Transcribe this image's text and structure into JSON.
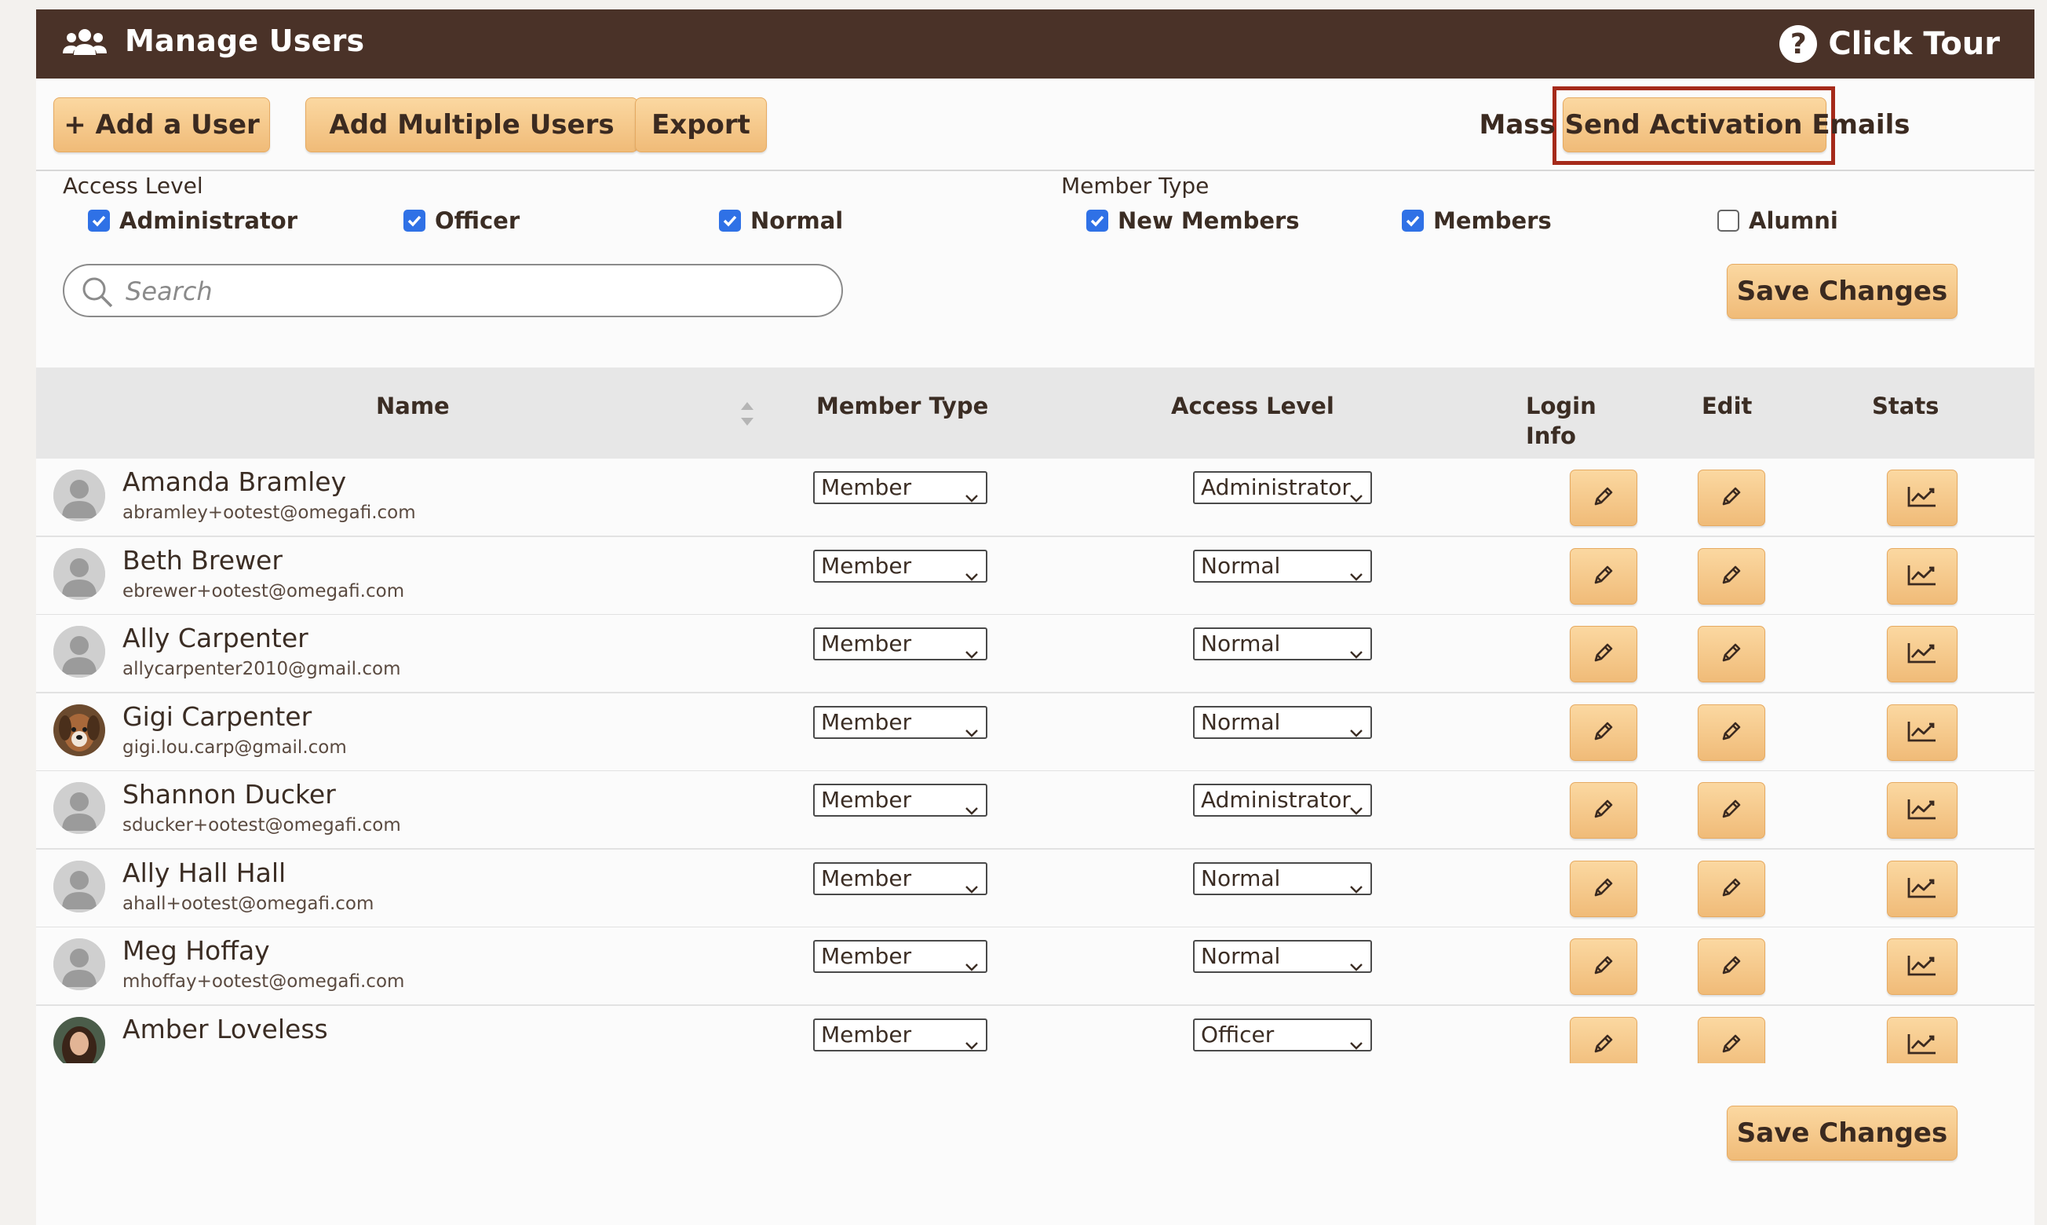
{
  "header": {
    "title": "Manage Users",
    "tour_label": "Click Tour",
    "help_glyph": "?"
  },
  "toolbar": {
    "add_user": "+ Add a User",
    "add_multiple": "Add Multiple Users",
    "export": "Export",
    "mass_send": "Mass Send Activation Emails"
  },
  "filters": {
    "access_level_label": "Access Level",
    "access_levels": [
      {
        "label": "Administrator",
        "checked": true
      },
      {
        "label": "Officer",
        "checked": true
      },
      {
        "label": "Normal",
        "checked": true
      }
    ],
    "member_type_label": "Member Type",
    "member_types": [
      {
        "label": "New Members",
        "checked": true
      },
      {
        "label": "Members",
        "checked": true
      },
      {
        "label": "Alumni",
        "checked": false
      }
    ]
  },
  "search": {
    "placeholder": "Search",
    "value": ""
  },
  "save_label": "Save Changes",
  "table": {
    "columns": {
      "name": "Name",
      "member_type": "Member Type",
      "access_level": "Access Level",
      "login_info": "Login Info",
      "edit": "Edit",
      "stats": "Stats"
    },
    "rows": [
      {
        "name": "Amanda Bramley",
        "email": "abramley+ootest@omegafi.com",
        "member_type": "Member",
        "access_level": "Administrator",
        "avatar": "placeholder"
      },
      {
        "name": "Beth Brewer",
        "email": "ebrewer+ootest@omegafi.com",
        "member_type": "Member",
        "access_level": "Normal",
        "avatar": "placeholder"
      },
      {
        "name": "Ally Carpenter",
        "email": "allycarpenter2010@gmail.com",
        "member_type": "Member",
        "access_level": "Normal",
        "avatar": "placeholder"
      },
      {
        "name": "Gigi Carpenter",
        "email": "gigi.lou.carp@gmail.com",
        "member_type": "Member",
        "access_level": "Normal",
        "avatar": "dog-photo"
      },
      {
        "name": "Shannon Ducker",
        "email": "sducker+ootest@omegafi.com",
        "member_type": "Member",
        "access_level": "Administrator",
        "avatar": "placeholder"
      },
      {
        "name": "Ally Hall Hall",
        "email": "ahall+ootest@omegafi.com",
        "member_type": "Member",
        "access_level": "Normal",
        "avatar": "placeholder"
      },
      {
        "name": "Meg Hoffay",
        "email": "mhoffay+ootest@omegafi.com",
        "member_type": "Member",
        "access_level": "Normal",
        "avatar": "placeholder"
      },
      {
        "name": "Amber Loveless",
        "email": "",
        "member_type": "Member",
        "access_level": "Officer",
        "avatar": "person-photo"
      }
    ]
  },
  "icons": {
    "header": "users-icon",
    "tour": "help-icon",
    "search": "search-icon",
    "sort": "sort-icon",
    "login": "pencil-icon",
    "edit": "pencil-icon",
    "stats": "chart-line-icon"
  },
  "colors": {
    "header_bg": "#4a3228",
    "button_top": "#fbd8a1",
    "button_bottom": "#f0bb78",
    "highlight": "#a52a1a",
    "checkbox": "#2f71e6"
  }
}
